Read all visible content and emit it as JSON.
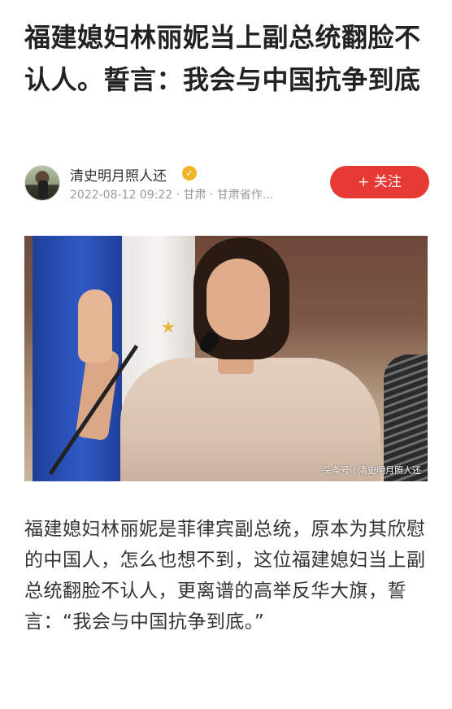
{
  "article": {
    "title": "福建媳妇林丽妮当上副总统翻脸不认人。誓言：我会与中国抗争到底",
    "author": {
      "name": "清史明月照人还",
      "verified_icon": "verified-badge-icon",
      "meta": "2022-08-12 09:22 · 甘肃 · 甘肃省作..."
    },
    "follow_button": "+ 关注",
    "image": {
      "watermark": "头条号 | 清史明月照人还"
    },
    "body": "福建媳妇林丽妮是菲律宾副总统，原本为其欣慰的中国人，怎么也想不到，这位福建媳妇当上副总统翻脸不认人，更离谱的高举反华大旗，誓言：“我会与中国抗争到底。”"
  },
  "colors": {
    "follow_button": "#e83a34",
    "verified_badge": "#f0b429",
    "meta_text": "#999999",
    "title_text": "#222222"
  }
}
